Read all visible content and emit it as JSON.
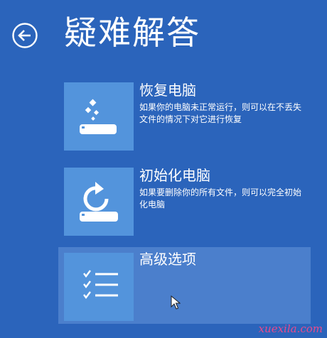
{
  "page": {
    "title": "疑难解答",
    "back_icon": "back-arrow-icon"
  },
  "options": [
    {
      "title": "恢复电脑",
      "description": "如果你的电脑未正常运行，则可以在不丢失文件的情况下对它进行恢复",
      "icon": "refresh-pc-icon"
    },
    {
      "title": "初始化电脑",
      "description": "如果要删除你的所有文件，则可以完全初始化电脑",
      "icon": "reset-pc-icon"
    },
    {
      "title": "高级选项",
      "description": "",
      "icon": "checklist-icon",
      "selected": true
    }
  ],
  "watermark": "xuexila.com",
  "colors": {
    "background": "#2b64bb",
    "tile": "#5394dc",
    "selected_row": "#4b7fcc",
    "text": "#ffffff",
    "watermark": "#e84a8c"
  }
}
